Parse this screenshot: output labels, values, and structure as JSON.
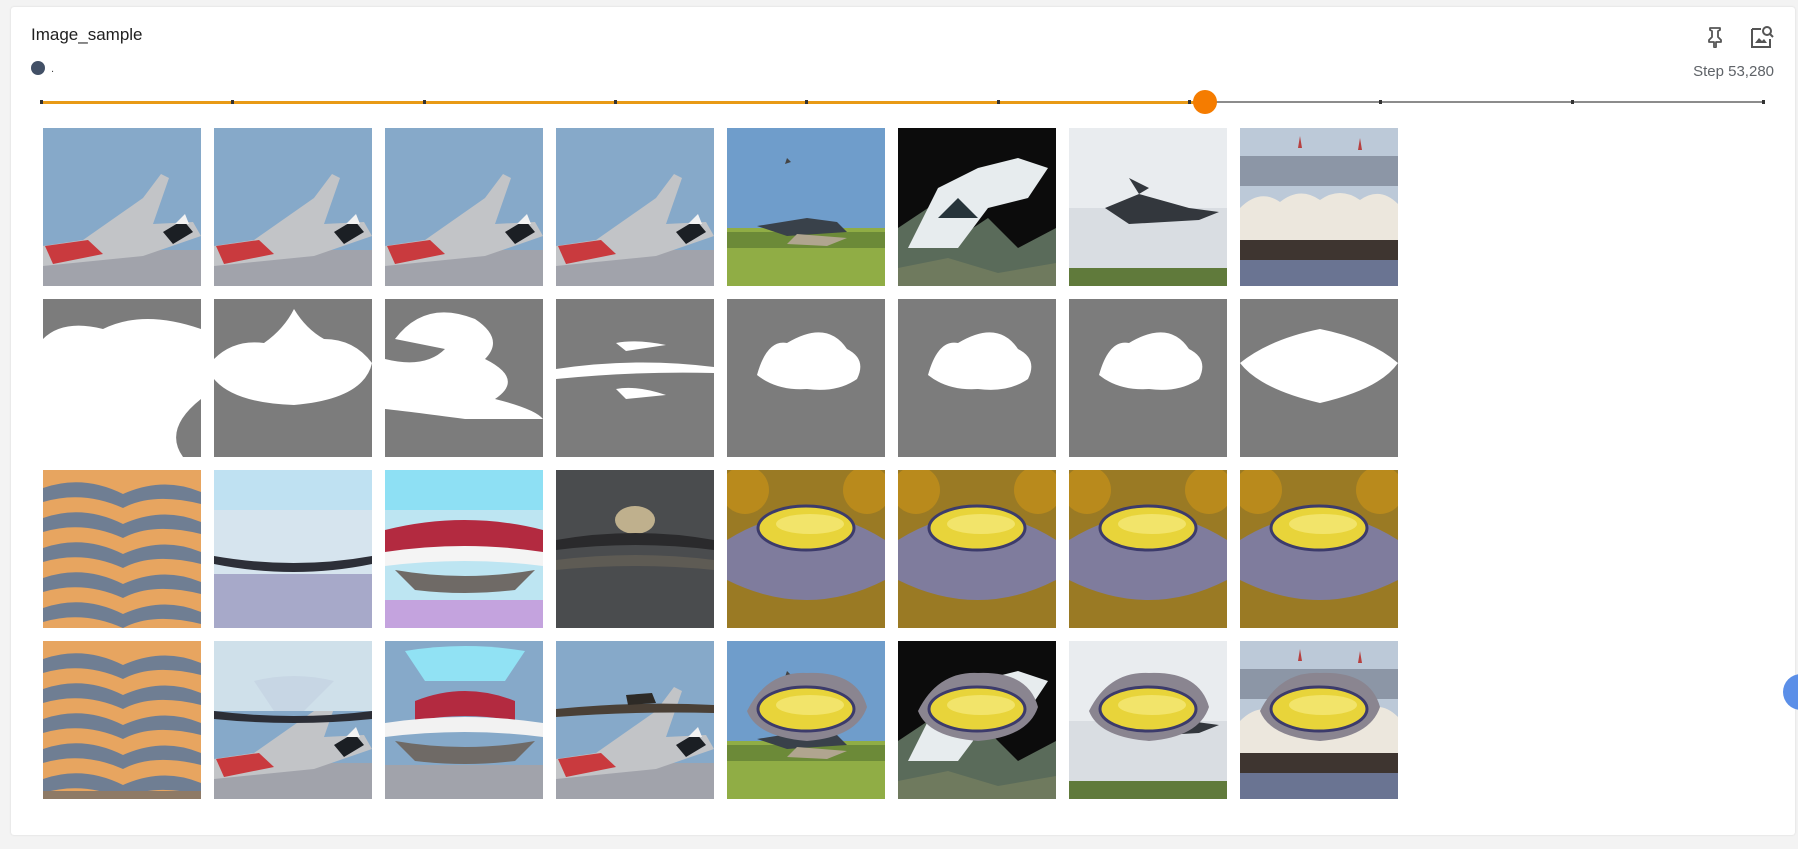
{
  "card": {
    "title": "Image_sample",
    "run_label": ".",
    "step_text": "Step 53,280",
    "icons": {
      "pin": "pin-icon",
      "fullscreen": "image-search-icon"
    }
  },
  "slider": {
    "ticks": 10,
    "value_fraction": 0.6757,
    "accent": "#e89a16",
    "thumb_color": "#f57c00"
  },
  "grid": {
    "rows": [
      {
        "name": "input-images",
        "cells": [
          "plane-red",
          "plane-red",
          "plane-red",
          "plane-red",
          "jet-field",
          "jet-forest",
          "jet-sky",
          "tent-crowd"
        ]
      },
      {
        "name": "masks",
        "cells": [
          "mask-large",
          "mask-hill",
          "mask-stack",
          "mask-thin",
          "mask-blob",
          "mask-blob",
          "mask-blob",
          "mask-lens"
        ]
      },
      {
        "name": "generated-patches",
        "cells": [
          "patch-orange",
          "patch-sky",
          "patch-redwhite",
          "patch-dark",
          "patch-lemon",
          "patch-lemon",
          "patch-lemon",
          "patch-lemon"
        ]
      },
      {
        "name": "composited-images",
        "cells": [
          "comp-orange",
          "comp-sky-plane",
          "comp-redwhite",
          "comp-plane-bar",
          "comp-lemon-field",
          "comp-lemon-forest",
          "comp-lemon-sky",
          "comp-lemon-tent"
        ]
      }
    ]
  }
}
